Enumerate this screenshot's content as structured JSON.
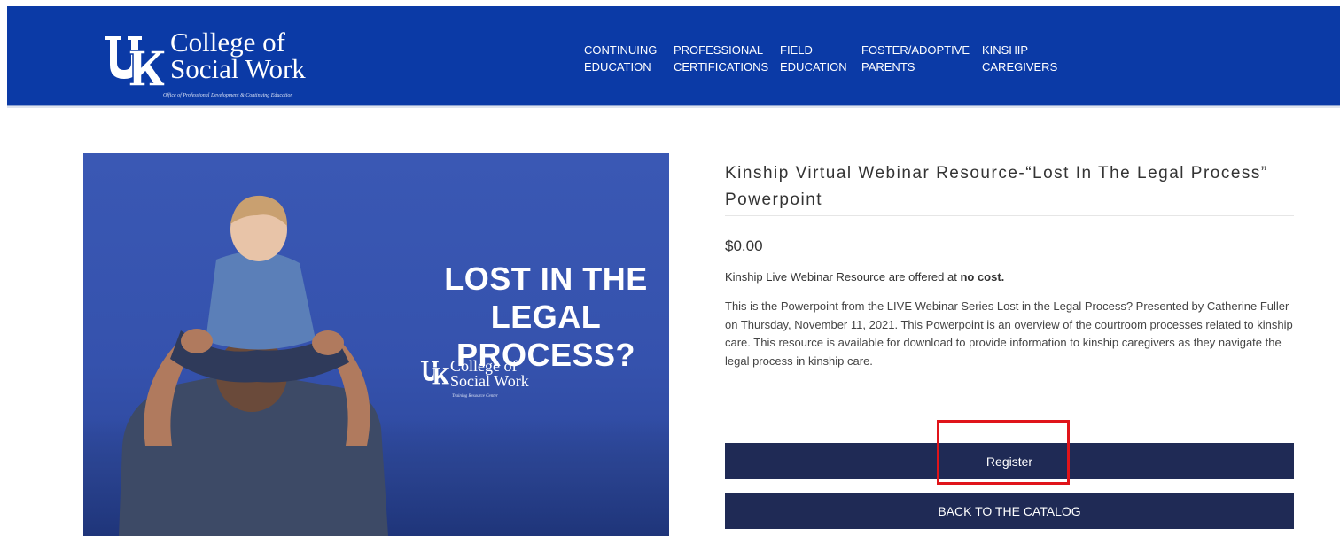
{
  "header": {
    "logo": {
      "line1": "College of",
      "line2": "Social Work",
      "tagline": "Office of Professional Development & Continuing Education"
    },
    "nav": [
      {
        "line1": "CONTINUING",
        "line2": "EDUCATION"
      },
      {
        "line1": "PROFESSIONAL",
        "line2": "CERTIFICATIONS"
      },
      {
        "line1": "FIELD",
        "line2": "EDUCATION"
      },
      {
        "line1": "FOSTER/ADOPTIVE",
        "line2": "PARENTS"
      },
      {
        "line1": "KINSHIP",
        "line2": "CAREGIVERS"
      }
    ]
  },
  "hero": {
    "headline_line1": "LOST IN THE",
    "headline_line2": "LEGAL PROCESS?",
    "logo_line1": "College of",
    "logo_line2": "Social Work",
    "logo_tagline": "Training Resource Center"
  },
  "product": {
    "title": "Kinship Virtual Webinar Resource-“Lost In The Legal Process” Powerpoint",
    "price": "$0.00",
    "intro_text": "Kinship Live Webinar Resource are offered at ",
    "intro_bold": "no cost.",
    "description": "This is the Powerpoint from the LIVE Webinar Series Lost in the Legal Process? Presented by Catherine Fuller on Thursday, November 11, 2021. This Powerpoint is an overview of the courtroom processes related to kinship care. This resource is available for download to provide information to kinship caregivers as they navigate the legal process in kinship care."
  },
  "buttons": {
    "register": "Register",
    "back": "BACK TO THE CATALOG"
  },
  "colors": {
    "header_blue": "#0b3aa6",
    "button_navy": "#1f2a55",
    "highlight_red": "#e0141a"
  }
}
